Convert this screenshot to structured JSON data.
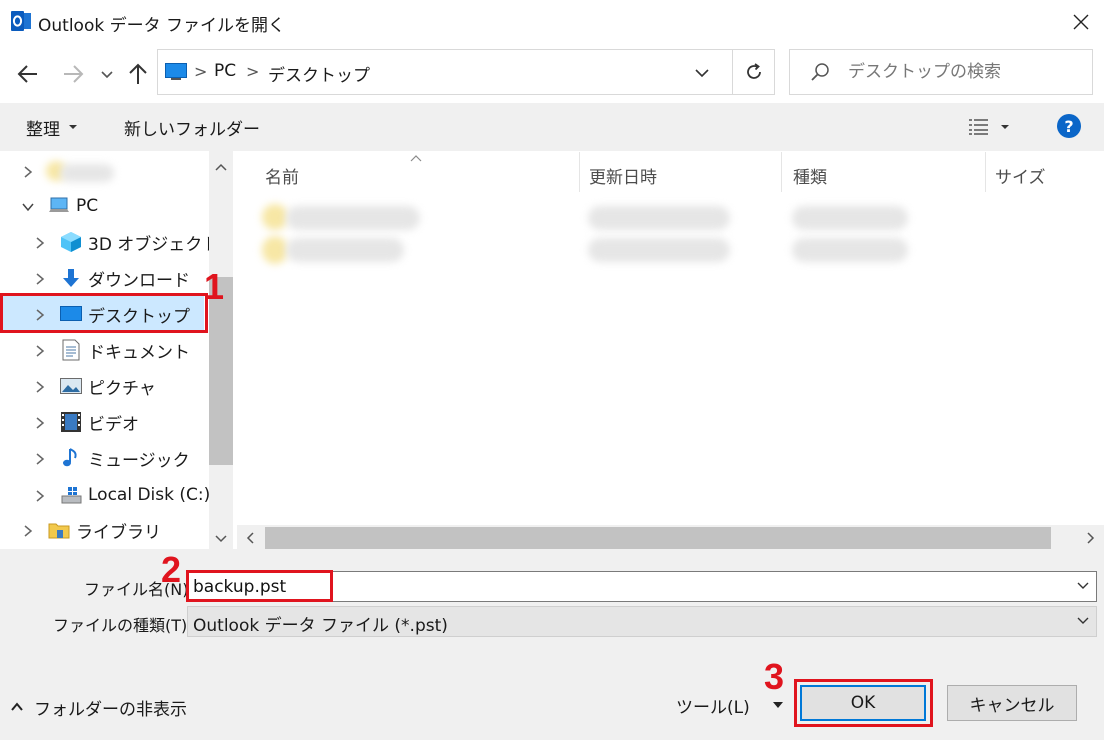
{
  "window": {
    "title": "Outlook データ ファイルを開く",
    "app_icon": "outlook-icon"
  },
  "address": {
    "crumbs": [
      "PC",
      "デスクトップ"
    ],
    "separator": ">"
  },
  "search": {
    "placeholder": "デスクトップの検索"
  },
  "toolbar": {
    "organize_label": "整理",
    "new_folder_label": "新しいフォルダー",
    "help_label": "?"
  },
  "nav": {
    "items": [
      {
        "label": "PC",
        "icon": "pc-icon"
      },
      {
        "label": "3D オブジェクト",
        "icon": "3d-objects-icon"
      },
      {
        "label": "ダウンロード",
        "icon": "download-icon"
      },
      {
        "label": "デスクトップ",
        "icon": "desktop-icon",
        "selected": true
      },
      {
        "label": "ドキュメント",
        "icon": "document-icon"
      },
      {
        "label": "ピクチャ",
        "icon": "pictures-icon"
      },
      {
        "label": "ビデオ",
        "icon": "video-icon"
      },
      {
        "label": "ミュージック",
        "icon": "music-icon"
      },
      {
        "label": "Local Disk (C:)",
        "icon": "disk-icon"
      },
      {
        "label": "ライブラリ",
        "icon": "library-icon"
      }
    ]
  },
  "list": {
    "columns": [
      "名前",
      "更新日時",
      "種類",
      "サイズ"
    ]
  },
  "form": {
    "filename_label": "ファイル名(N):",
    "filename_value": "backup.pst",
    "filetype_label": "ファイルの種類(T):",
    "filetype_value": "Outlook データ ファイル (*.pst)"
  },
  "footer": {
    "hide_folders_label": "フォルダーの非表示",
    "tools_label": "ツール(L)",
    "ok_label": "OK",
    "cancel_label": "キャンセル"
  },
  "annotations": {
    "step1": "1",
    "step2": "2",
    "step3": "3",
    "color": "#e0141e"
  },
  "colors": {
    "accent": "#0078d7",
    "selection": "#cce8ff",
    "toolbar_bg": "#f0f0f0"
  }
}
